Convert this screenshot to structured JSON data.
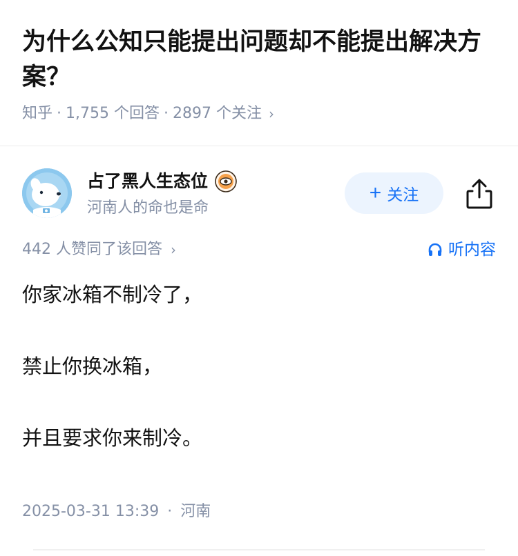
{
  "question": {
    "title": "为什么公知只能提出问题却不能提出解决方案？",
    "source": "知乎",
    "answers_count": "1,755 个回答",
    "followers_count": "2897 个关注"
  },
  "author": {
    "name": "占了黑人生态位",
    "bio": "河南人的命也是命",
    "follow_label": "关注"
  },
  "answer": {
    "votes": "442 人赞同了该回答",
    "listen_label": "听内容",
    "paragraphs": [
      "你家冰箱不制冷了，",
      "禁止你换冰箱，",
      "并且要求你来制冷。"
    ],
    "date": "2025-03-31 13:39",
    "location": "河南"
  },
  "colors": {
    "accent": "#1772f6",
    "muted_text": "#8590a6",
    "follow_bg": "#ecf4fe"
  },
  "icons": {
    "share": "share-icon",
    "headphones": "headphones-icon",
    "chevron": "chevron-right-icon",
    "badge": "eye-badge-icon"
  }
}
